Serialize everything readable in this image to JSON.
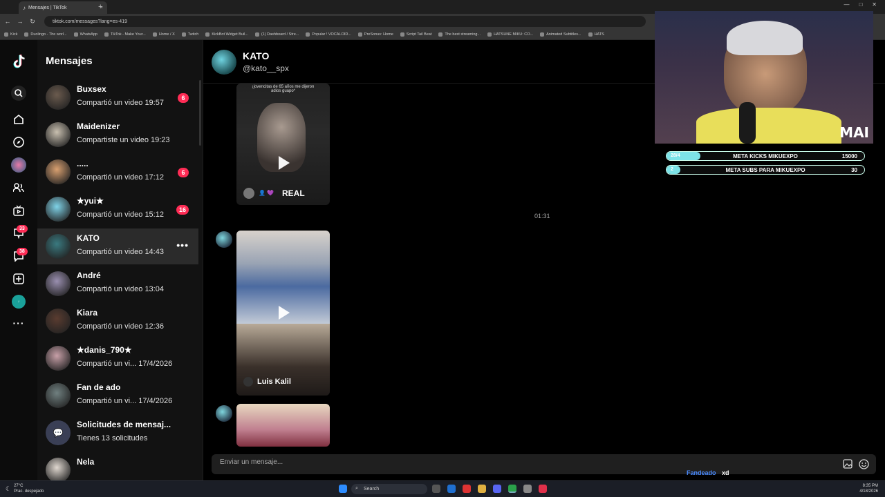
{
  "browser": {
    "tab_title": "Mensajes | TikTok",
    "tab_close": "×",
    "new_tab": "+",
    "url": "tiktok.com/messages?lang=es-419",
    "bookmarks": [
      "Kick",
      "Duolingo - The worl...",
      "WhatsApp",
      "TikTok - Make Your...",
      "Home / X",
      "Twitch",
      "KickBot Widget Buil...",
      "(1) Dashboard / Stre...",
      "Popular ! VOCALOID...",
      "PreSonus: Home",
      "Script Tail Beat",
      "The best streaming...",
      "HATSUNE MIKU: CO...",
      "Animated Subtitles...",
      "HATS"
    ]
  },
  "rail": {
    "icons": [
      "tiktok-logo",
      "search",
      "home",
      "explore",
      "live",
      "following",
      "live-tv",
      "activity",
      "messages",
      "upload",
      "lite",
      "more"
    ],
    "activity_badge": "33",
    "messages_badge": "38"
  },
  "sidebar": {
    "title": "Mensajes",
    "conversations": [
      {
        "name": "Buxsex",
        "preview": "Compartió un video 19:57",
        "badge": "6",
        "color": "#6b5b4e"
      },
      {
        "name": "Maidenizer",
        "preview": "Compartiste un video 19:23",
        "badge": "",
        "color": "#c9c0b0"
      },
      {
        "name": ".....",
        "preview": "Compartió un video 17:12",
        "badge": "6",
        "color": "#d9a070"
      },
      {
        "name": "★yui★",
        "preview": "Compartió un video 15:12",
        "badge": "16",
        "color": "#7fd3e8"
      },
      {
        "name": "KATO",
        "preview": "Compartió un video 14:43",
        "badge": "",
        "color": "#3a7a80",
        "more": "•••"
      },
      {
        "name": "André",
        "preview": "Compartió un video 13:04",
        "badge": "",
        "color": "#9a8fb0"
      },
      {
        "name": "Kiara",
        "preview": "Compartió un video 12:36",
        "badge": "",
        "color": "#5a3c30"
      },
      {
        "name": "★danis_790★",
        "preview": "Compartió un vi... 17/4/2026",
        "badge": "",
        "color": "#c8a0a8"
      },
      {
        "name": "Fan de ado",
        "preview": "Compartió un vi... 17/4/2026",
        "badge": "",
        "color": "#708080"
      },
      {
        "name": "Solicitudes de mensaj...",
        "preview": "Tienes 13 solicitudes",
        "badge": "",
        "color": "#3a3f55"
      },
      {
        "name": "Nela",
        "preview": "",
        "badge": "",
        "color": "#e0d8d0"
      }
    ]
  },
  "chat": {
    "name": "KATO",
    "handle": "@kato__spx",
    "video1_caption": "¡jovencitas de 65 años me dijeron adios guapo*",
    "video1_user": "REAL",
    "timestamp": "01:31",
    "video2_user": "Luis Kalil",
    "input_placeholder": "Enviar un mensaje..."
  },
  "stream": {
    "watermark": "MAI",
    "meta1_count": "28/4",
    "meta1_label": "META KICKS MIKUEXPO",
    "meta1_target": "15000",
    "meta1_progress": 0.17,
    "meta2_count": "2",
    "meta2_label": "META SUBS PARA MIKUEXPO",
    "meta2_target": "30",
    "meta2_progress": 0.07,
    "chat_user": "Fandeado",
    "chat_text": "xd"
  },
  "taskbar": {
    "temp": "27°C",
    "weather": "Prac. despejado",
    "search": "Search",
    "time": "8:35 PM",
    "date": "4/18/2026"
  }
}
